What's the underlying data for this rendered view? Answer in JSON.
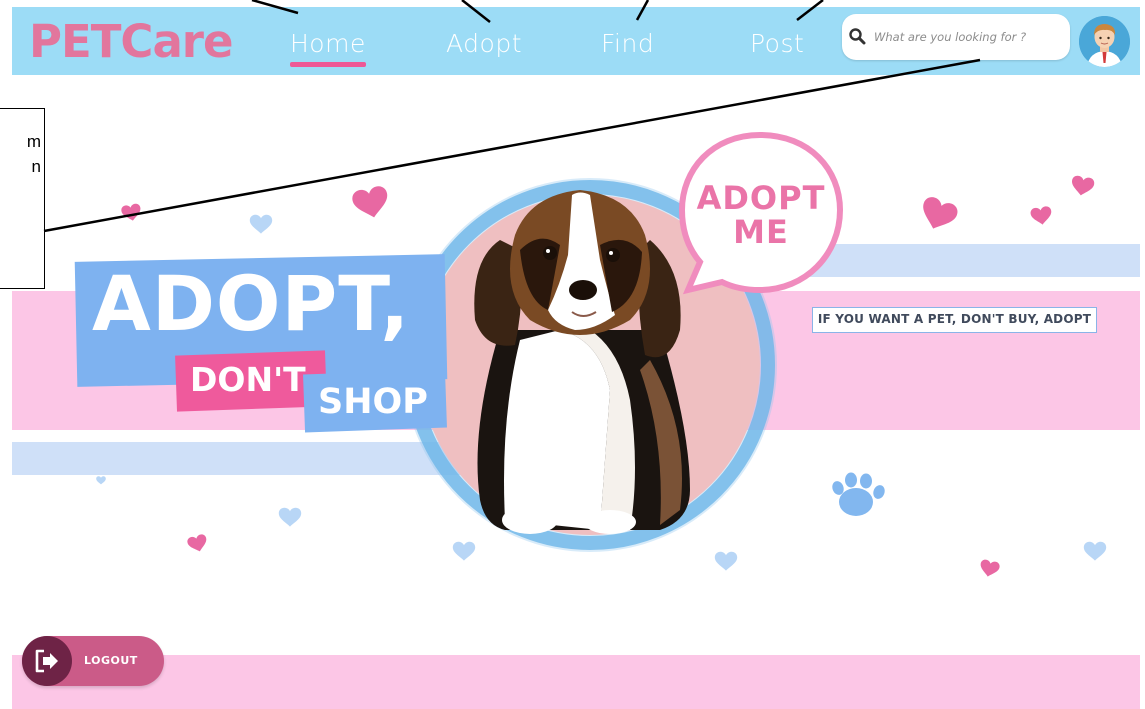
{
  "brand": {
    "logo_text": "PETCare"
  },
  "nav": {
    "items": [
      {
        "label": "Home",
        "active": true
      },
      {
        "label": "Adopt",
        "active": false
      },
      {
        "label": "Find",
        "active": false
      },
      {
        "label": "Post",
        "active": false
      }
    ]
  },
  "search": {
    "placeholder": "What are you looking for ?",
    "value": ""
  },
  "annotation": {
    "text": "m\nn"
  },
  "hero": {
    "headline": "ADOPT,",
    "dont": "DON'T",
    "shop": "SHOP",
    "bubble_line1": "ADOPT",
    "bubble_line2": "ME",
    "tagline": "IF YOU WANT A PET, DON'T BUY, ADOPT"
  },
  "logout": {
    "label": "LOGOUT"
  },
  "colors": {
    "navbar": "#9cdcf6",
    "brand_pink": "#e2769d",
    "accent_pink": "#ee5896",
    "band_pink": "#fcc6e6",
    "band_blue": "#cfe0f8",
    "headline_blue": "#7eb2f0",
    "logout": "#cb5b88"
  },
  "icons": {
    "search": "search-icon",
    "logout": "logout-icon",
    "avatar": "user-avatar",
    "decor": [
      "heart-icon",
      "paw-icon"
    ]
  }
}
